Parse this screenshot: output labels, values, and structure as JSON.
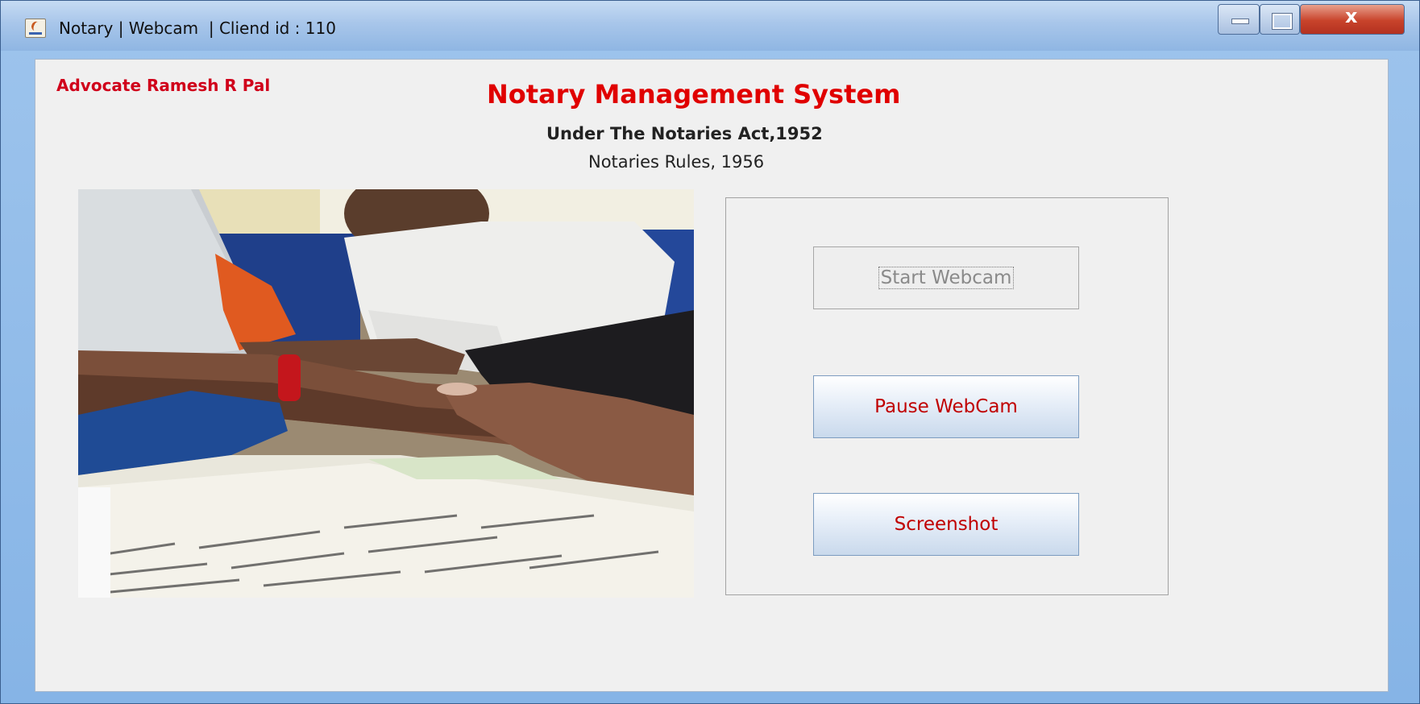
{
  "window": {
    "title": "Notary | Webcam  | Cliend id : 110",
    "icon": "java-cup-icon",
    "controls": [
      "minimize",
      "maximize",
      "close"
    ]
  },
  "header": {
    "advocate": "Advocate Ramesh R Pal",
    "title": "Notary Management System",
    "subtitle": "Under The Notaries Act,1952",
    "rules": "Notaries Rules, 1956"
  },
  "webcam": {
    "feed_label": "webcam-feed"
  },
  "buttons": {
    "start": "Start Webcam",
    "pause": "Pause WebCam",
    "screenshot": "Screenshot"
  },
  "colors": {
    "accent": "#e00000",
    "disabled_text": "#8a8a8a"
  }
}
